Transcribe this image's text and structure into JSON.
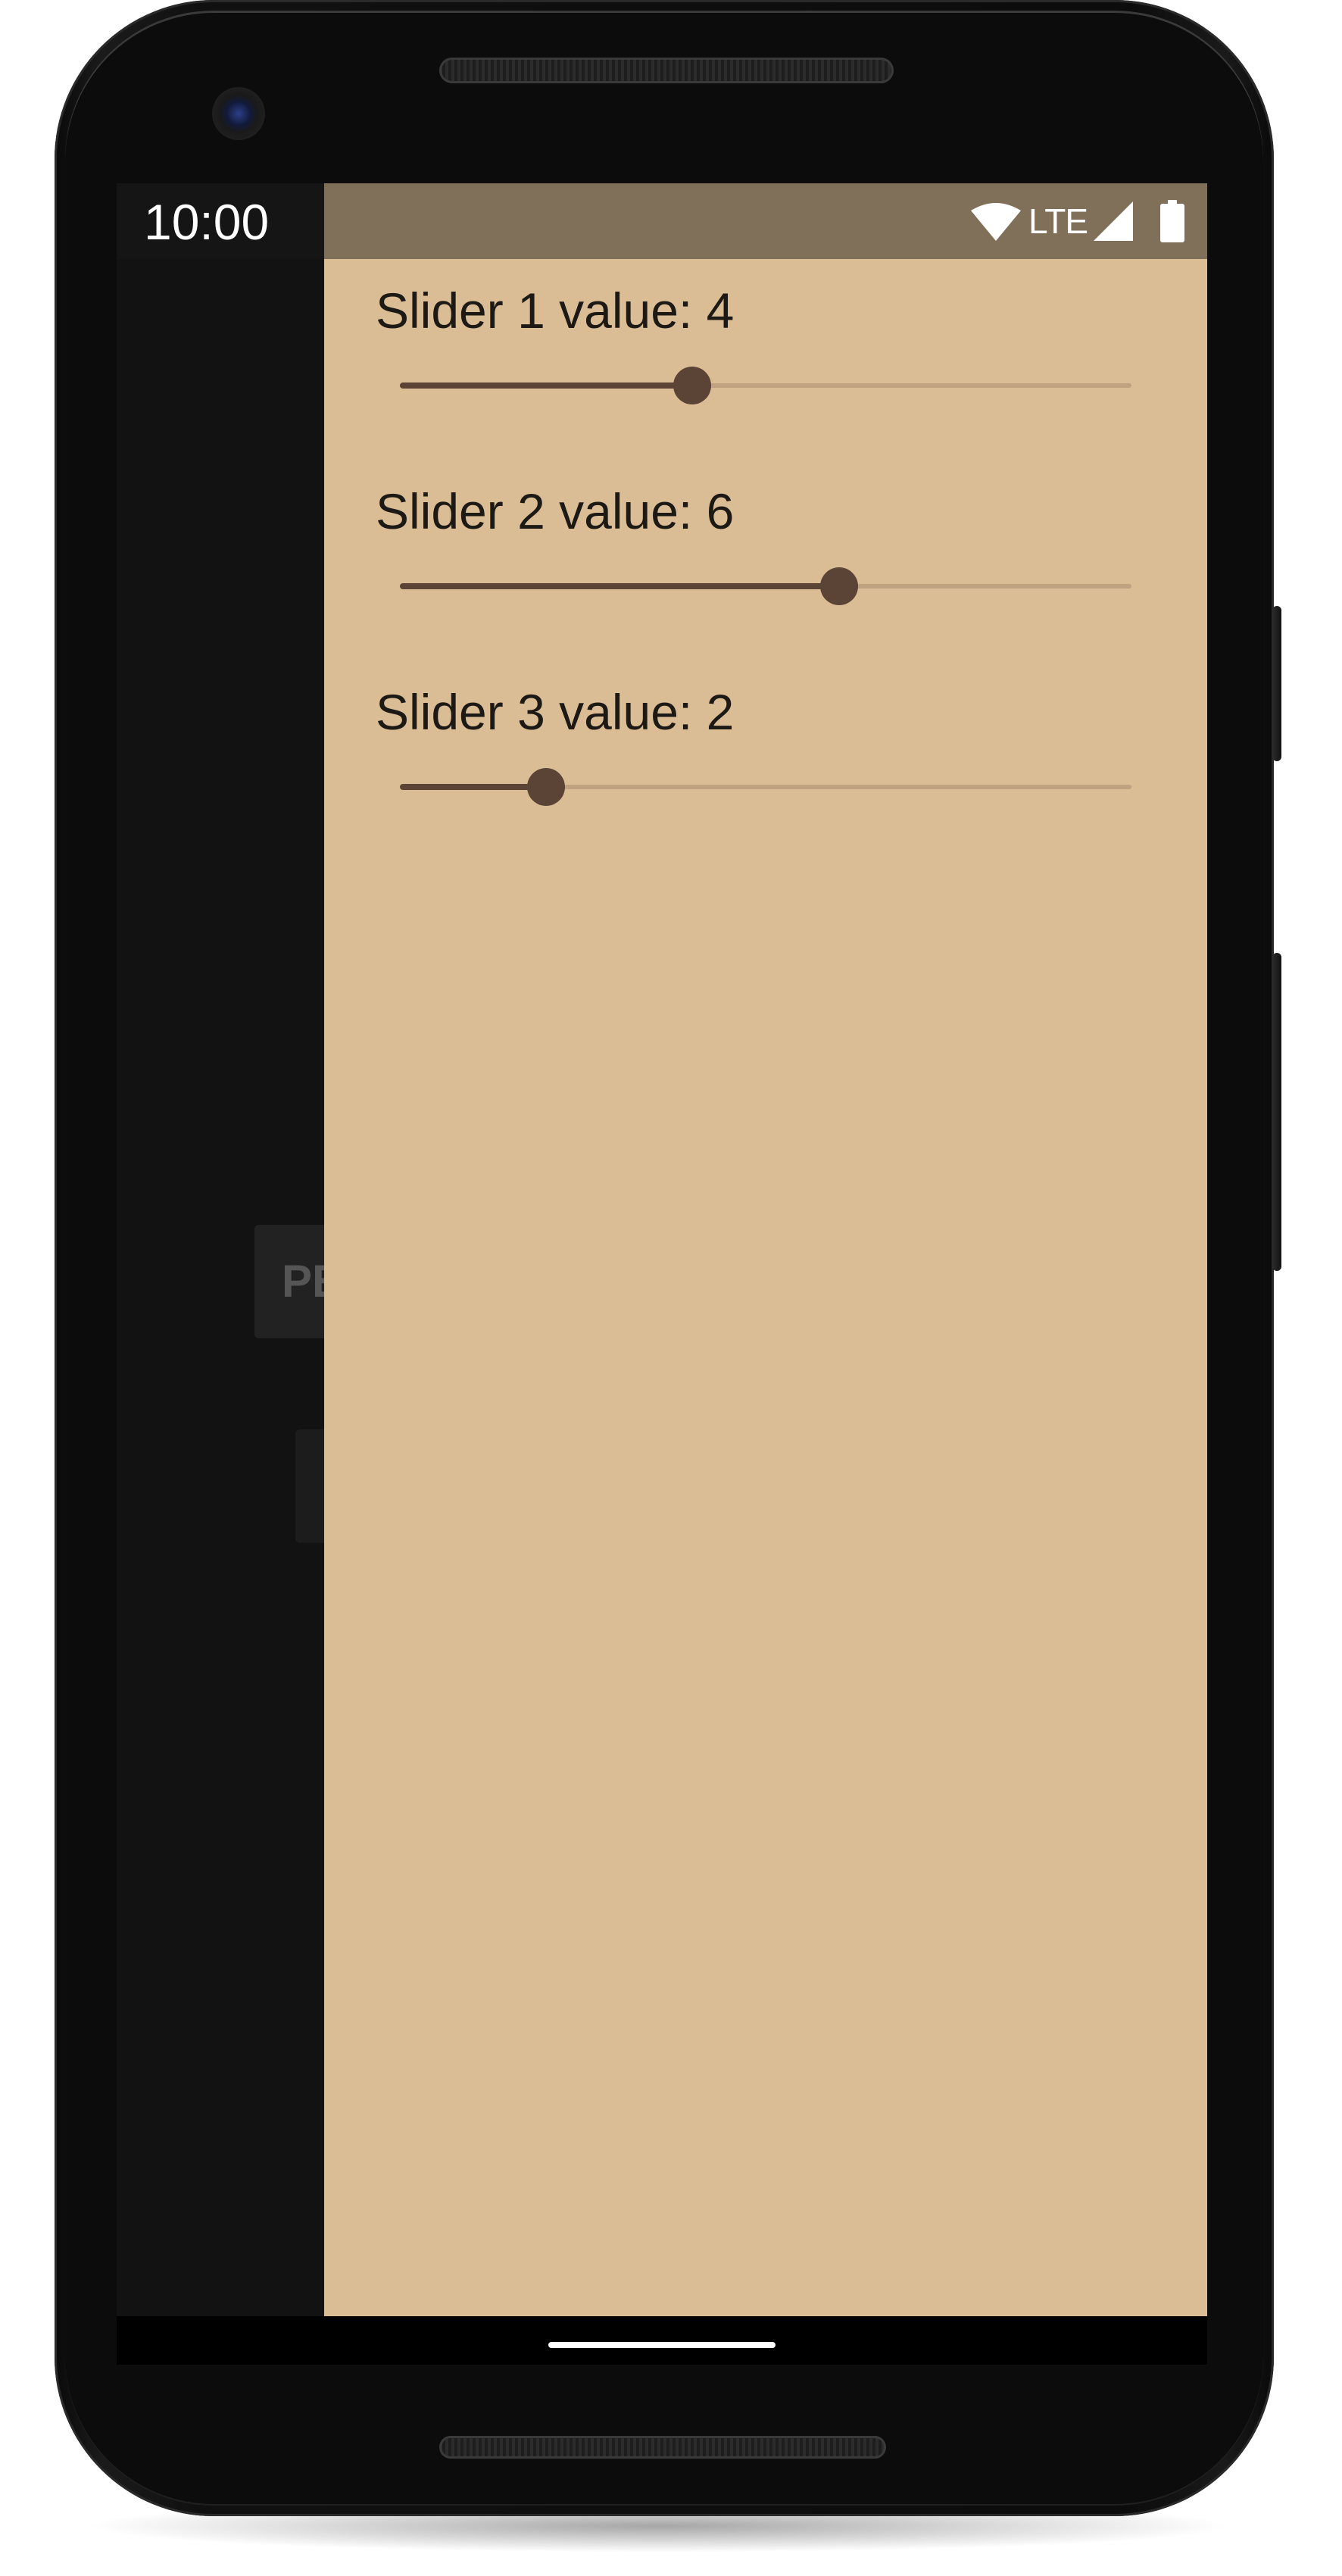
{
  "device": {
    "model_icon": "android-phone-frame-icon"
  },
  "status_bar": {
    "time": "10:00",
    "network_label": "LTE",
    "icons": [
      "wifi-icon",
      "cellular-signal-icon",
      "battery-icon"
    ]
  },
  "background_app": {
    "peek_button_text": "PE"
  },
  "drawer": {
    "background_color": "#dbbd95",
    "status_bar_color": "#80705a",
    "slider_active_color": "#5b4436",
    "slider_inactive_color": "#bfa27f",
    "sliders": [
      {
        "label": "Slider 1 value: 4",
        "value": 4,
        "min": 0,
        "max": 10
      },
      {
        "label": "Slider 2 value: 6",
        "value": 6,
        "min": 0,
        "max": 10
      },
      {
        "label": "Slider 3 value: 2",
        "value": 2,
        "min": 0,
        "max": 10
      }
    ]
  }
}
